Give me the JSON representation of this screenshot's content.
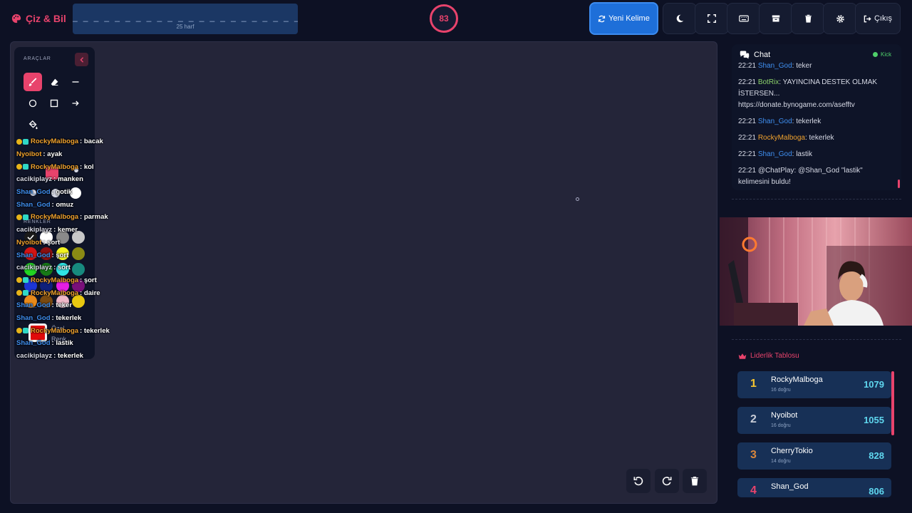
{
  "brand": {
    "title": "Çiz & Bil"
  },
  "word": {
    "dashes": "_ _ _ _ _ _ _ _ _ _ _ _ _ _ _ _ _ _ _ _ _ _ _ _ _",
    "hint": "25 harf"
  },
  "timer": {
    "value": "83"
  },
  "toolbar": {
    "new_word": "Yeni Kelime",
    "logout": "Çıkış",
    "icons": [
      "moon-icon",
      "fullscreen-icon",
      "keyboard-icon",
      "archive-icon",
      "trash-icon",
      "gear-icon",
      "logout-icon"
    ]
  },
  "tools": {
    "title": "ARAÇLAR",
    "colors_title": "RENKLER",
    "custom_label": "Özel Renk"
  },
  "overlay_chat": [
    {
      "user": "RockyMalboga",
      "badges": true,
      "color": "#f0a22e",
      "msg": ": bacak"
    },
    {
      "user": "Nyoibot",
      "badges": false,
      "color": "#f0a22e",
      "msg": ": ayak"
    },
    {
      "user": "RockyMalboga",
      "badges": true,
      "color": "#f0a22e",
      "msg": ": kol"
    },
    {
      "user": "cacikiplayz",
      "badges": false,
      "color": "#d9dbe8",
      "msg": ": manken"
    },
    {
      "user": "Shan_God",
      "badges": false,
      "color": "#3f8ff0",
      "msg": ": gotik"
    },
    {
      "user": "Shan_God",
      "badges": false,
      "color": "#3f8ff0",
      "msg": ": omuz"
    },
    {
      "user": "RockyMalboga",
      "badges": true,
      "color": "#f0a22e",
      "msg": ": parmak"
    },
    {
      "user": "cacikiplayz",
      "badges": false,
      "color": "#d9dbe8",
      "msg": ": kemer"
    },
    {
      "user": "Nyoibot",
      "badges": false,
      "color": "#f0a22e",
      "msg": ": şort"
    },
    {
      "user": "Shan_God",
      "badges": false,
      "color": "#3f8ff0",
      "msg": ": şort"
    },
    {
      "user": "cacikiplayz",
      "badges": false,
      "color": "#d9dbe8",
      "msg": ": sort"
    },
    {
      "user": "RockyMalboga",
      "badges": true,
      "color": "#f0a22e",
      "msg": ": şort"
    },
    {
      "user": "RockyMalboga",
      "badges": true,
      "color": "#f0a22e",
      "msg": ": daire"
    },
    {
      "user": "Shan_God",
      "badges": false,
      "color": "#3f8ff0",
      "msg": ": teker"
    },
    {
      "user": "Shan_God",
      "badges": false,
      "color": "#3f8ff0",
      "msg": ": tekerlek"
    },
    {
      "user": "RockyMalboga",
      "badges": true,
      "color": "#f0a22e",
      "msg": ": tekerlek"
    },
    {
      "user": "Shan_God",
      "badges": false,
      "color": "#3f8ff0",
      "msg": ": lastik"
    },
    {
      "user": "cacikiplayz",
      "badges": false,
      "color": "#d9dbe8",
      "msg": ": tekerlek"
    }
  ],
  "chat": {
    "title": "Chat",
    "platform": "Kick",
    "messages": [
      {
        "time": "22:21",
        "user": "Shan_God",
        "color": "#3f8ff0",
        "text": ": teker"
      },
      {
        "time": "22:21",
        "user": "BotRix",
        "color": "#8bd16a",
        "text": ": YAYINCINA DESTEK OLMAK İSTERSEN... https://donate.bynogame.com/asefftv"
      },
      {
        "time": "22:21",
        "user": "Shan_God",
        "color": "#3f8ff0",
        "text": ": tekerlek"
      },
      {
        "time": "22:21",
        "user": "RockyMalboga",
        "color": "#f0a22e",
        "text": ": tekerlek"
      },
      {
        "time": "22:21",
        "user": "Shan_God",
        "color": "#3f8ff0",
        "text": ": lastik"
      },
      {
        "time": "22:21",
        "user": "@ChatPlay",
        "color": "#d7dae6",
        "text": ": @Shan_God \"lastik\" kelimesini buldu!"
      }
    ]
  },
  "leaderboard": {
    "title": "Liderlik Tablosu",
    "rows": [
      {
        "rank": "1",
        "name": "RockyMalboga",
        "sub": "16 doğru",
        "score": "1079",
        "rank_color": "#f4c430"
      },
      {
        "rank": "2",
        "name": "Nyoibot",
        "sub": "16 doğru",
        "score": "1055",
        "rank_color": "#c8ccd6"
      },
      {
        "rank": "3",
        "name": "CherryTokio",
        "sub": "14 doğru",
        "score": "828",
        "rank_color": "#d9873d"
      },
      {
        "rank": "4",
        "name": "Shan_God",
        "sub": "",
        "score": "806",
        "rank_color": "#e8436c"
      }
    ]
  },
  "colors": {
    "accent": "#e8436c",
    "primary": "#1e6fd9",
    "canvas": "#242539"
  }
}
